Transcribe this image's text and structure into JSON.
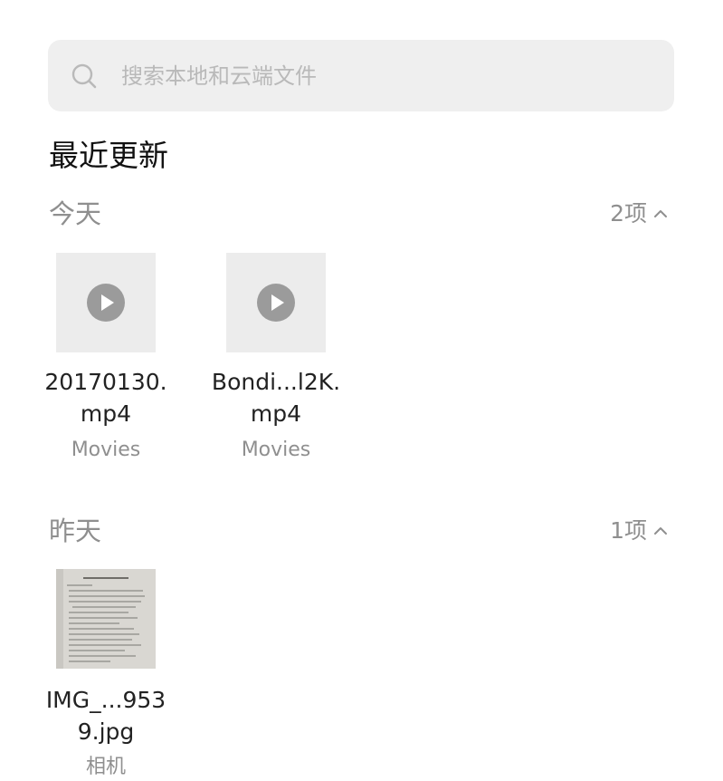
{
  "search": {
    "placeholder": "搜索本地和云端文件",
    "icon": "search-icon"
  },
  "title": "最近更新",
  "groups": [
    {
      "label": "今天",
      "count": "2项",
      "files": [
        {
          "name": "20170130.mp4",
          "name_line1": "20170130.",
          "name_line2": "mp4",
          "source": "Movies",
          "type": "video"
        },
        {
          "name": "Bondi...l2K.mp4",
          "name_line1": "Bondi...l2K.",
          "name_line2": "mp4",
          "source": "Movies",
          "type": "video"
        }
      ]
    },
    {
      "label": "昨天",
      "count": "1项",
      "files": [
        {
          "name": "IMG_...9539.jpg",
          "name_line1": "IMG_...953",
          "name_line2": "9.jpg",
          "source": "相机",
          "type": "image"
        }
      ]
    }
  ],
  "colors": {
    "background": "#ffffff",
    "search_bg": "#efefef",
    "muted_text": "#8f8f8f",
    "thumb_bg": "#ececec",
    "play_badge": "#9b9b9b"
  }
}
